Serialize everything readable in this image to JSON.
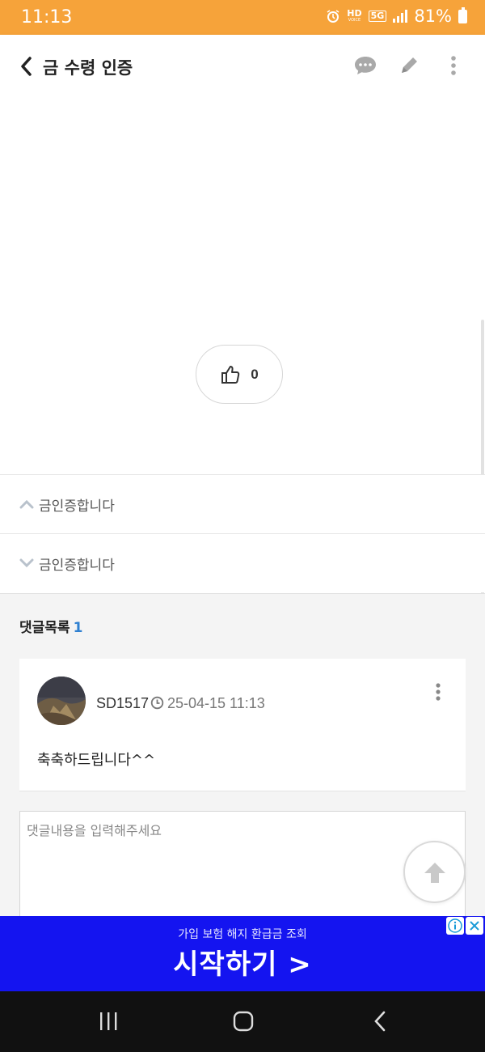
{
  "status_bar": {
    "time": "11:13",
    "hd_label": "HD",
    "voice_label": "VOICE",
    "network_label": "5G",
    "battery": "81%"
  },
  "header": {
    "title": "금 수령 인증",
    "icons": [
      "back-icon",
      "comment-bubble-icon",
      "pencil-icon",
      "more-vertical-icon"
    ]
  },
  "post": {
    "like_count": "0"
  },
  "nav": {
    "prev_label": "금인증합니다",
    "next_label": "금인증합니다"
  },
  "comments": {
    "heading": "댓글목록",
    "count": "1",
    "items": [
      {
        "author": "SD1517",
        "date": "25-04-15 11:13",
        "body": "축축하드립니다^^"
      }
    ],
    "input_placeholder": "댓글내용을 입력해주세요"
  },
  "ad": {
    "small_text": "가입 보험 해지 환급금 조회",
    "cta": "시작하기 >"
  },
  "colors": {
    "status_bar": "#f6a33a",
    "accent_blue": "#2f80d1",
    "ad_background": "#1414f0"
  }
}
